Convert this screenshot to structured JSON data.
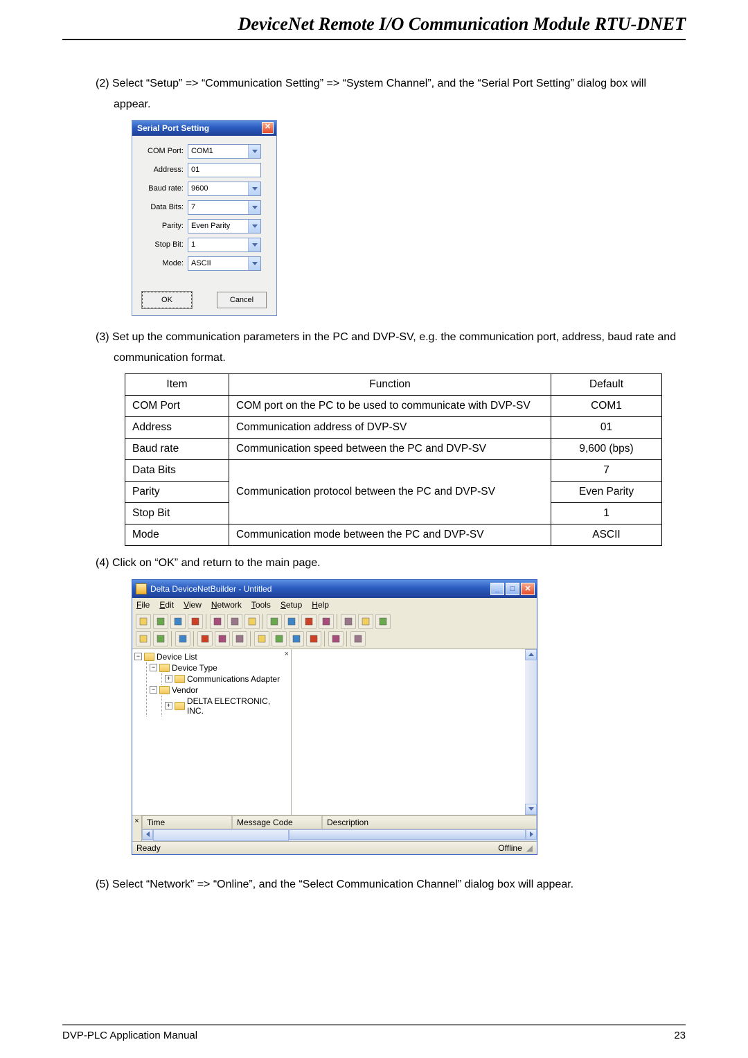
{
  "header": {
    "title": "DeviceNet Remote I/O Communication Module RTU-DNET"
  },
  "steps": {
    "s2": "(2) Select “Setup” => “Communication Setting” => “System Channel”, and the “Serial Port Setting” dialog box will appear.",
    "s3": "(3) Set up the communication parameters in the PC and DVP-SV, e.g. the communication port, address, baud rate and communication format.",
    "s4": "(4) Click on “OK” and return to the main page.",
    "s5": "(5) Select “Network” => “Online”, and the “Select Communication Channel” dialog box will appear."
  },
  "sps_dialog": {
    "title": "Serial Port Setting",
    "rows": [
      {
        "label": "COM Port:",
        "value": "COM1",
        "dropdown": true
      },
      {
        "label": "Address:",
        "value": "01",
        "dropdown": false
      },
      {
        "label": "Baud rate:",
        "value": "9600",
        "dropdown": true
      },
      {
        "label": "Data Bits:",
        "value": "7",
        "dropdown": true
      },
      {
        "label": "Parity:",
        "value": "Even Parity",
        "dropdown": true
      },
      {
        "label": "Stop Bit:",
        "value": "1",
        "dropdown": true
      },
      {
        "label": "Mode:",
        "value": "ASCII",
        "dropdown": true
      }
    ],
    "ok": "OK",
    "cancel": "Cancel"
  },
  "param_table": {
    "headers": {
      "item": "Item",
      "func": "Function",
      "def": "Default"
    },
    "rows": [
      {
        "item": "COM Port",
        "func": "COM port on the PC to be used to communicate with DVP-SV",
        "def": "COM1"
      },
      {
        "item": "Address",
        "func": "Communication address of DVP-SV",
        "def": "01"
      },
      {
        "item": "Baud rate",
        "func": "Communication speed between the PC and DVP-SV",
        "def": "9,600 (bps)"
      },
      {
        "item": "Data Bits",
        "func": "",
        "def": "7",
        "merge": "top"
      },
      {
        "item": "Parity",
        "func": "Communication protocol between the PC and DVP-SV",
        "def": "Even Parity",
        "merge": "mid"
      },
      {
        "item": "Stop Bit",
        "func": "",
        "def": "1",
        "merge": "bot"
      },
      {
        "item": "Mode",
        "func": "Communication mode between the PC and DVP-SV",
        "def": "ASCII"
      }
    ]
  },
  "appwin": {
    "title": "Delta DeviceNetBuilder - Untitled",
    "menus": [
      "File",
      "Edit",
      "View",
      "Network",
      "Tools",
      "Setup",
      "Help"
    ],
    "tree": {
      "root": "Device List",
      "children": [
        {
          "label": "Device Type",
          "expanded": true,
          "children": [
            {
              "label": "Communications Adapter",
              "expanded": false
            }
          ]
        },
        {
          "label": "Vendor",
          "expanded": true,
          "children": [
            {
              "label": "DELTA ELECTRONIC, INC.",
              "expanded": false
            }
          ]
        }
      ]
    },
    "msg_headers": {
      "time": "Time",
      "code": "Message Code",
      "desc": "Description"
    },
    "status_left": "Ready",
    "status_right": "Offline"
  },
  "footer": {
    "left": "DVP-PLC Application Manual",
    "right": "23"
  }
}
